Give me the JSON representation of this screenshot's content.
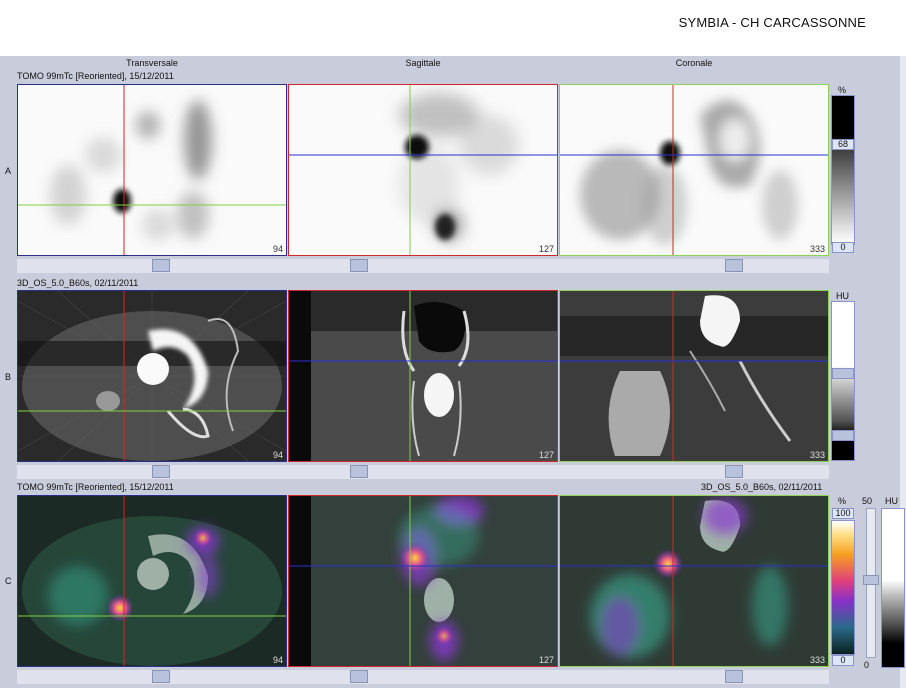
{
  "header": {
    "title": "SYMBIA - CH CARCASSONNE"
  },
  "view_titles": [
    "Transversale",
    "Sagittale",
    "Coronale"
  ],
  "rows": [
    {
      "letter": "A",
      "series_label": "TOMO 99mTc [Reoriented], 15/12/2011",
      "slice_numbers": [
        "94",
        "127",
        "333"
      ]
    },
    {
      "letter": "B",
      "series_label": "3D_OS_5.0_B60s, 02/11/2011",
      "slice_numbers": [
        "94",
        "127",
        "333"
      ]
    },
    {
      "letter": "C",
      "series_label": "TOMO 99mTc [Reoriented], 15/12/2011",
      "series_label_right": "3D_OS_5.0_B60s, 02/11/2011",
      "slice_numbers": [
        "94",
        "127",
        "333"
      ]
    }
  ],
  "lut_a": {
    "unit": "%",
    "level": "68",
    "min": "0"
  },
  "lut_b": {
    "unit": "HU"
  },
  "lut_c": {
    "unit": "%",
    "max": "100",
    "min": "0",
    "fusion_value": "50",
    "fusion_min": "0",
    "ct_unit": "HU"
  },
  "colors": {
    "frame_transverse": "#2a2f8a",
    "frame_sagittal": "#d02828",
    "frame_coronal": "#8ed255",
    "cross_red": "#e02020",
    "cross_green": "#7fd23a",
    "cross_blue": "#2a2fd0"
  },
  "icons": [
    "slider-thumb-icon"
  ]
}
